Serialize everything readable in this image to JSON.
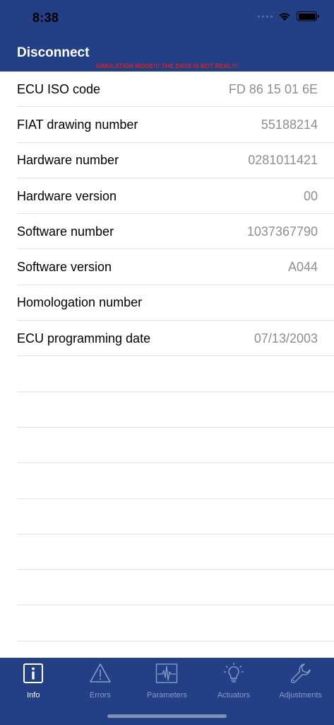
{
  "status_bar": {
    "time": "8:38"
  },
  "nav": {
    "title": "Disconnect",
    "banner": "SIMULATION MODE!!! THE DATA IS NOT REAL!!!"
  },
  "rows": [
    {
      "label": "ECU ISO code",
      "value": "FD 86 15 01 6E"
    },
    {
      "label": "FIAT drawing number",
      "value": "55188214"
    },
    {
      "label": "Hardware number",
      "value": "0281011421"
    },
    {
      "label": "Hardware version",
      "value": "00"
    },
    {
      "label": "Software number",
      "value": "1037367790"
    },
    {
      "label": "Software version",
      "value": "A044"
    },
    {
      "label": "Homologation number",
      "value": ""
    },
    {
      "label": "ECU programming date",
      "value": "07/13/2003"
    }
  ],
  "tabs": [
    {
      "label": "Info",
      "icon": "info-icon",
      "active": true
    },
    {
      "label": "Errors",
      "icon": "warning-icon",
      "active": false
    },
    {
      "label": "Parameters",
      "icon": "waveform-icon",
      "active": false
    },
    {
      "label": "Actuators",
      "icon": "lightbulb-icon",
      "active": false
    },
    {
      "label": "Adjustments",
      "icon": "wrench-icon",
      "active": false
    }
  ],
  "colors": {
    "header_bg": "#233f86",
    "banner_text": "#e0201f",
    "inactive_tab": "#8a9bc6",
    "value_text": "#8e8e93"
  }
}
